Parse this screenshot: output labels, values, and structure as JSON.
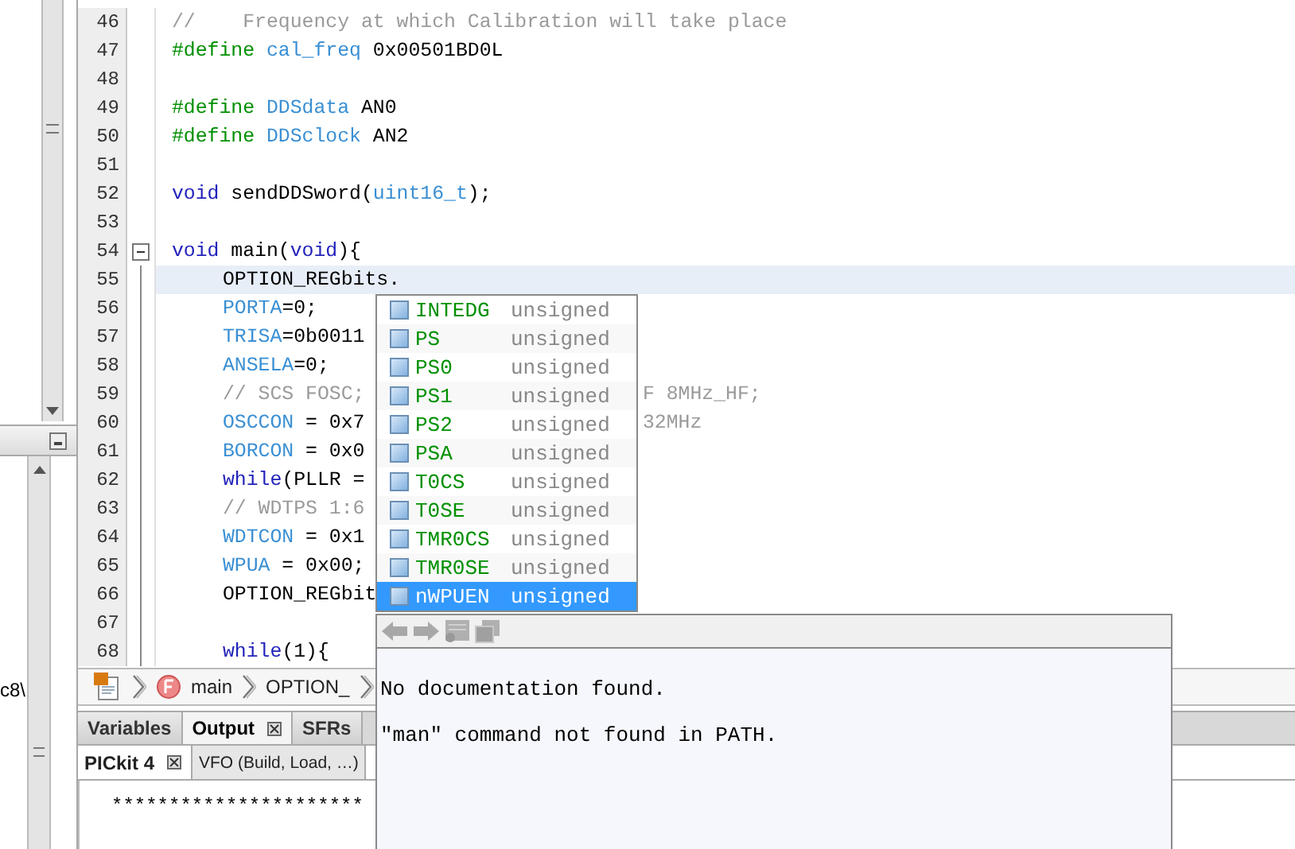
{
  "side_text": "c8\\",
  "editor": {
    "lines": [
      {
        "number": "46",
        "indented": false,
        "current": false,
        "tokens": [
          {
            "kind": "comment",
            "text": "//    Frequency at which Calibration will take place"
          }
        ]
      },
      {
        "number": "47",
        "indented": false,
        "current": false,
        "tokens": [
          {
            "kind": "directive",
            "text": "#define"
          },
          {
            "kind": "macro",
            "text": "cal_freq"
          },
          {
            "kind": "plain",
            "text": " 0x00501BD0L"
          }
        ]
      },
      {
        "number": "48",
        "current": false
      },
      {
        "number": "49",
        "indented": false,
        "current": false,
        "tokens": [
          {
            "kind": "directive",
            "text": "#define"
          },
          {
            "kind": "macro",
            "text": "DDSdata"
          },
          {
            "kind": "plain",
            "text": " AN0"
          }
        ]
      },
      {
        "number": "50",
        "indented": false,
        "current": false,
        "tokens": [
          {
            "kind": "directive",
            "text": "#define"
          },
          {
            "kind": "macro",
            "text": "DDSclock"
          },
          {
            "kind": "plain",
            "text": " AN2"
          }
        ]
      },
      {
        "number": "51",
        "current": false
      },
      {
        "number": "52",
        "indented": false,
        "current": false,
        "tokens": [
          {
            "kind": "keyword",
            "text": "void"
          },
          {
            "kind": "plain",
            "text": " sendDDSword("
          },
          {
            "kind": "macro",
            "text": "uint16_t"
          },
          {
            "kind": "plain",
            "text": ");"
          }
        ]
      },
      {
        "number": "53",
        "current": false
      },
      {
        "number": "54",
        "indented": false,
        "current": false,
        "fold": {
          "expanded": true
        },
        "tokens": [
          {
            "kind": "keyword",
            "text": "void"
          },
          {
            "kind": "plain",
            "text": " main("
          },
          {
            "kind": "keyword",
            "text": "void"
          },
          {
            "kind": "plain",
            "text": "){"
          }
        ]
      },
      {
        "number": "55",
        "indented": true,
        "current": true,
        "tokens": [
          {
            "kind": "plain",
            "text": "OPTION_REGbits."
          }
        ]
      },
      {
        "number": "56",
        "indented": true,
        "current": false,
        "tokens": [
          {
            "kind": "macro",
            "text": "PORTA"
          },
          {
            "kind": "plain",
            "text": "=0;"
          }
        ]
      },
      {
        "number": "57",
        "indented": true,
        "current": false,
        "tokens": [
          {
            "kind": "macro",
            "text": "TRISA"
          },
          {
            "kind": "plain",
            "text": "=0b0011"
          }
        ]
      },
      {
        "number": "58",
        "indented": true,
        "current": false,
        "tokens": [
          {
            "kind": "macro",
            "text": "ANSELA"
          },
          {
            "kind": "plain",
            "text": "=0;"
          }
        ]
      },
      {
        "number": "59",
        "indented": true,
        "current": false,
        "tokens": [
          {
            "kind": "comment",
            "text": "// SCS FOSC;"
          }
        ],
        "tail": {
          "kind": "comment",
          "text": "F 8MHz_HF;"
        }
      },
      {
        "number": "60",
        "indented": true,
        "current": false,
        "tokens": [
          {
            "kind": "macro",
            "text": "OSCCON"
          },
          {
            "kind": "plain",
            "text": " = 0x7"
          }
        ],
        "tail": {
          "kind": "comment",
          "text": "32MHz"
        }
      },
      {
        "number": "61",
        "indented": true,
        "current": false,
        "tokens": [
          {
            "kind": "macro",
            "text": "BORCON"
          },
          {
            "kind": "plain",
            "text": " = 0x0"
          }
        ]
      },
      {
        "number": "62",
        "indented": true,
        "current": false,
        "tokens": [
          {
            "kind": "keyword",
            "text": "while"
          },
          {
            "kind": "plain",
            "text": "(PLLR ="
          }
        ]
      },
      {
        "number": "63",
        "indented": true,
        "current": false,
        "tokens": [
          {
            "kind": "comment",
            "text": "// WDTPS 1:6"
          }
        ]
      },
      {
        "number": "64",
        "indented": true,
        "current": false,
        "tokens": [
          {
            "kind": "macro",
            "text": "WDTCON"
          },
          {
            "kind": "plain",
            "text": " = 0x1"
          }
        ]
      },
      {
        "number": "65",
        "indented": true,
        "current": false,
        "tokens": [
          {
            "kind": "macro",
            "text": "WPUA"
          },
          {
            "kind": "plain",
            "text": " = 0x00;"
          }
        ]
      },
      {
        "number": "66",
        "indented": true,
        "current": false,
        "tokens": [
          {
            "kind": "plain",
            "text": "OPTION_REGbit"
          }
        ]
      },
      {
        "number": "67",
        "current": false
      },
      {
        "number": "68",
        "indented": true,
        "current": false,
        "tokens": [
          {
            "kind": "keyword",
            "text": "while"
          },
          {
            "kind": "plain",
            "text": "(1){"
          }
        ]
      }
    ]
  },
  "completion": {
    "items": [
      {
        "name": "INTEDG",
        "type": "unsigned",
        "selected": false
      },
      {
        "name": "PS",
        "type": "unsigned",
        "selected": false
      },
      {
        "name": "PS0",
        "type": "unsigned",
        "selected": false
      },
      {
        "name": "PS1",
        "type": "unsigned",
        "selected": false
      },
      {
        "name": "PS2",
        "type": "unsigned",
        "selected": false
      },
      {
        "name": "PSA",
        "type": "unsigned",
        "selected": false
      },
      {
        "name": "T0CS",
        "type": "unsigned",
        "selected": false
      },
      {
        "name": "T0SE",
        "type": "unsigned",
        "selected": false
      },
      {
        "name": "TMR0CS",
        "type": "unsigned",
        "selected": false
      },
      {
        "name": "TMR0SE",
        "type": "unsigned",
        "selected": false
      },
      {
        "name": "nWPUEN",
        "type": "unsigned",
        "selected": true
      }
    ]
  },
  "documentation": {
    "lines": [
      "No documentation found.",
      "\"man\" command not found in PATH."
    ]
  },
  "breadcrumb": {
    "function": "main",
    "member": "OPTION_"
  },
  "output_tabs": [
    {
      "label": "Variables",
      "selected": false,
      "closable": false
    },
    {
      "label": "Output",
      "selected": true,
      "closable": true
    },
    {
      "label": "SFRs",
      "selected": false,
      "closable": false
    }
  ],
  "output_subtabs": [
    {
      "label": "PICkit 4",
      "selected": true,
      "closable": true
    },
    {
      "label": "VFO (Build, Load, …)",
      "selected": false,
      "closable": false
    }
  ],
  "output_text": "**********************"
}
